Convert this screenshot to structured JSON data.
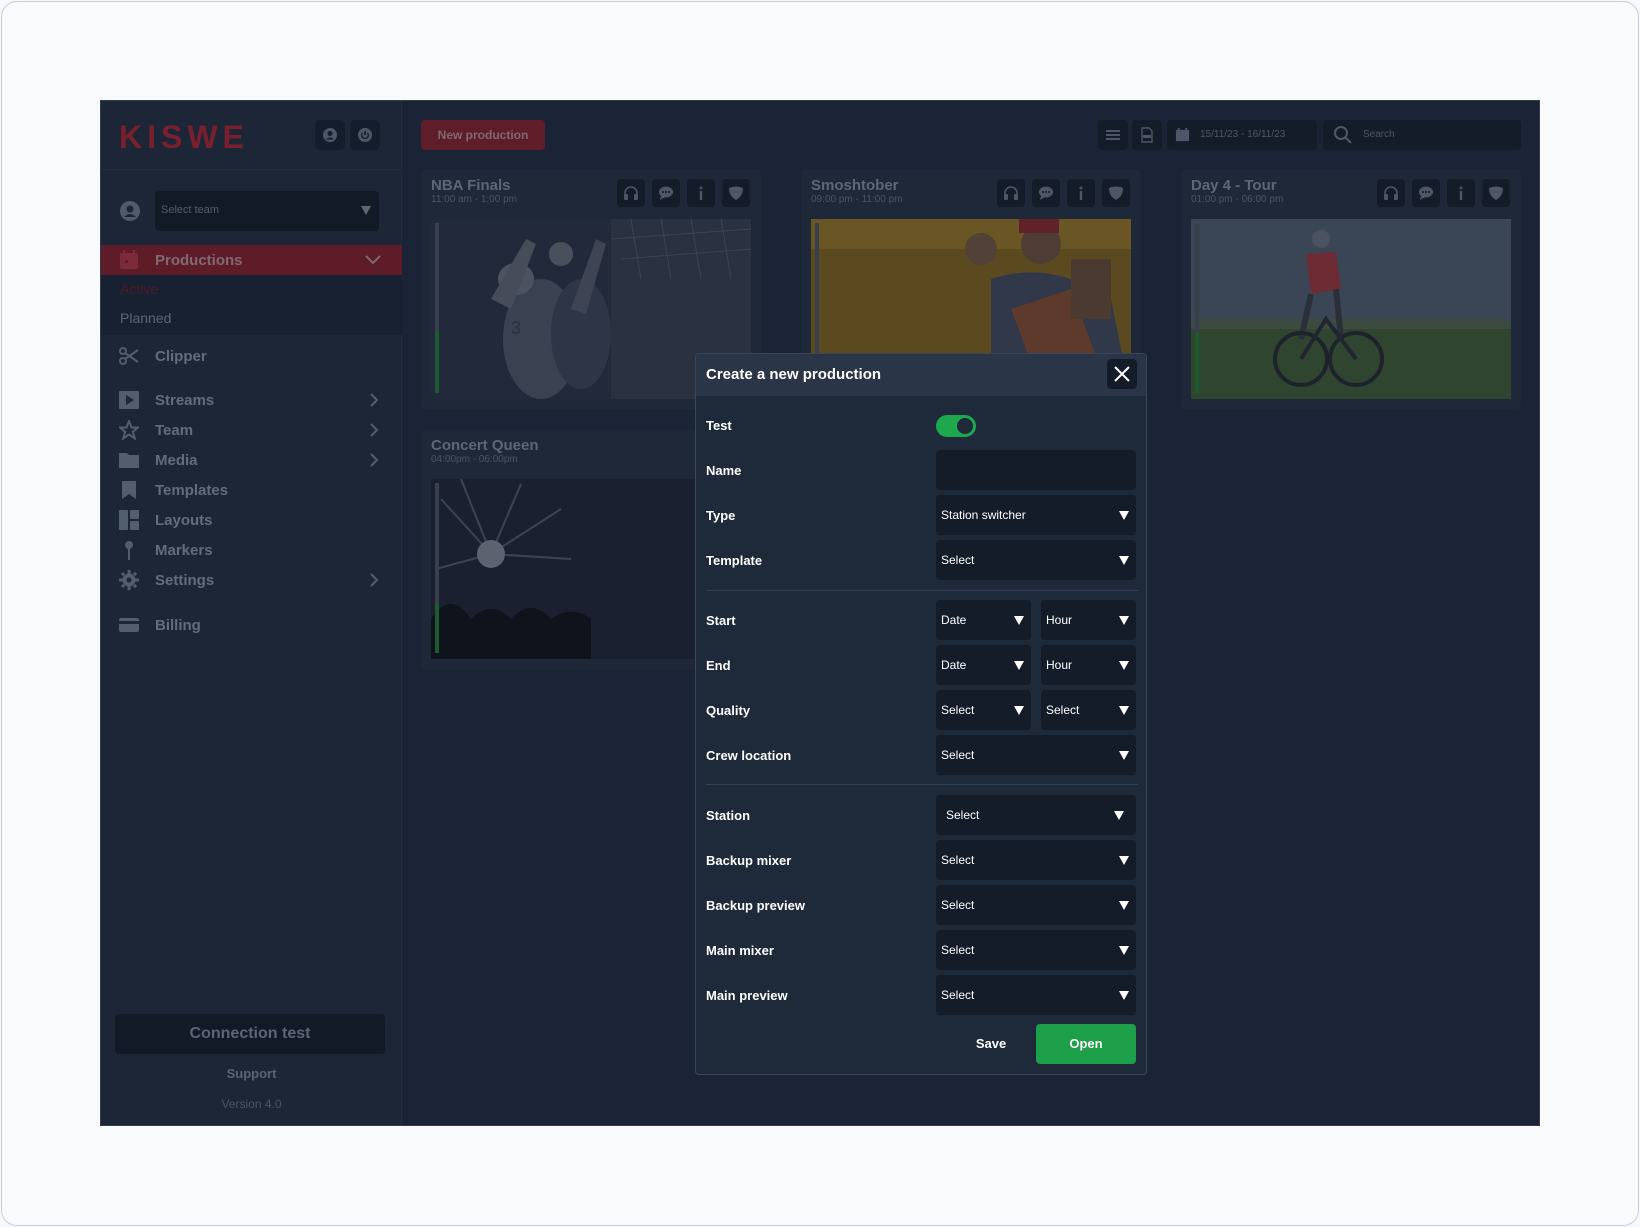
{
  "brand": {
    "logo": "KISWE",
    "accent": "#c8283f",
    "success": "#1ea84e"
  },
  "sidebar": {
    "select_team_placeholder": "Select team",
    "productions_label": "Productions",
    "sub_items": [
      "Active",
      "Planned"
    ],
    "items": [
      {
        "label": "Clipper",
        "icon": "scissors-icon"
      },
      {
        "label": "Streams",
        "icon": "play-icon"
      },
      {
        "label": "Team",
        "icon": "star-icon"
      },
      {
        "label": "Media",
        "icon": "folder-icon"
      },
      {
        "label": "Templates",
        "icon": "bookmark-icon"
      },
      {
        "label": "Layouts",
        "icon": "layout-icon"
      },
      {
        "label": "Markers",
        "icon": "pin-icon"
      },
      {
        "label": "Settings",
        "icon": "gear-icon"
      },
      {
        "label": "Billing",
        "icon": "card-icon"
      }
    ],
    "connection_test": "Connection test",
    "support": "Support",
    "version": "Version 4.0"
  },
  "toolbar": {
    "new_production": "New production",
    "date_range": "15/11/23 - 16/11/23",
    "search_placeholder": "Search"
  },
  "cards": [
    {
      "title": "NBA Finals",
      "time": "11:00 am - 1:00 pm"
    },
    {
      "title": "Smoshtober",
      "time": "09:00 pm - 11:00 pm"
    },
    {
      "title": "Day 4 - Tour",
      "time": "01:00 pm - 06:00 pm"
    },
    {
      "title": "Concert Queen",
      "time": "04:00pm - 06:00pm"
    }
  ],
  "modal": {
    "title": "Create a new production",
    "fields": {
      "test": "Test",
      "name": "Name",
      "name_value": "",
      "type": "Type",
      "type_value": "Station switcher",
      "template": "Template",
      "template_value": "Select",
      "start": "Start",
      "start_date": "Date",
      "start_hour": "Hour",
      "end": "End",
      "end_date": "Date",
      "end_hour": "Hour",
      "quality": "Quality",
      "quality_a": "Select",
      "quality_b": "Select",
      "crew_location": "Crew location",
      "crew_location_value": "Select",
      "station": "Station",
      "station_value": "Select",
      "backup_mixer": "Backup mixer",
      "backup_mixer_value": "Select",
      "backup_preview": "Backup preview",
      "backup_preview_value": "Select",
      "main_mixer": "Main mixer",
      "main_mixer_value": "Select",
      "main_preview": "Main preview",
      "main_preview_value": "Select"
    },
    "save_label": "Save",
    "open_label": "Open"
  }
}
